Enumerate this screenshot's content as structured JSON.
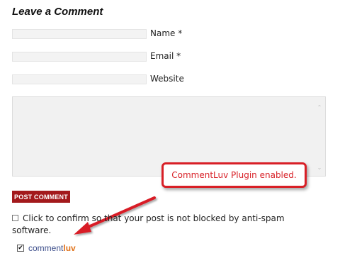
{
  "form": {
    "title": "Leave a Comment",
    "name_label": "Name *",
    "email_label": "Email *",
    "website_label": "Website",
    "post_button": "POST COMMENT",
    "confirm_text": "Click to confirm so that your post is not blocked by anti-spam software.",
    "confirm_checked": false
  },
  "commentluv": {
    "brand_part1": "comment",
    "brand_part2": "luv",
    "checked": true
  },
  "callout": {
    "text": "CommentLuv Plugin enabled."
  },
  "colors": {
    "accent_red": "#d81f26",
    "button_red": "#a3191c",
    "brand_blue": "#3b4d8a",
    "brand_orange": "#e0721a"
  },
  "icons": {
    "scroll_up": "chevron-up-icon",
    "scroll_down": "chevron-down-icon",
    "arrow": "red-arrow-icon"
  }
}
